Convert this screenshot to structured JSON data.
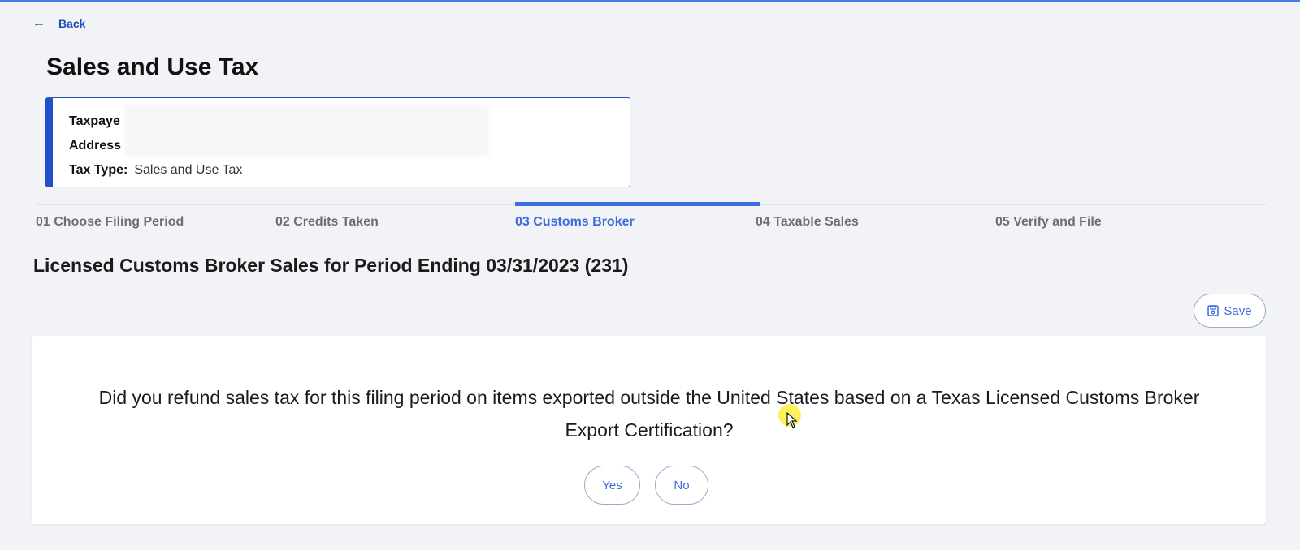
{
  "nav": {
    "back_label": "Back"
  },
  "page": {
    "title": "Sales and Use Tax"
  },
  "info_card": {
    "rows": [
      {
        "label": "Taxpaye",
        "value": ""
      },
      {
        "label": "Address",
        "value": ""
      },
      {
        "label": "Tax Type:",
        "value": "Sales and Use Tax"
      }
    ]
  },
  "steps": [
    {
      "label": "01 Choose Filing Period",
      "active": false
    },
    {
      "label": "02 Credits Taken",
      "active": false
    },
    {
      "label": "03 Customs Broker",
      "active": true
    },
    {
      "label": "04 Taxable Sales",
      "active": false
    },
    {
      "label": "05 Verify and File",
      "active": false
    }
  ],
  "section": {
    "title": "Licensed Customs Broker Sales for Period Ending 03/31/2023 (231)"
  },
  "toolbar": {
    "save_label": "Save",
    "save_icon": "floppy-disk-icon"
  },
  "question": {
    "text": "Did you refund sales tax for this filing period on items exported outside the United States based on a Texas Licensed Customs Broker Export Certification?",
    "yes_label": "Yes",
    "no_label": "No"
  },
  "colors": {
    "accent": "#3d6cde",
    "card_border": "#1f4fc9",
    "background": "#f2f3f6"
  }
}
